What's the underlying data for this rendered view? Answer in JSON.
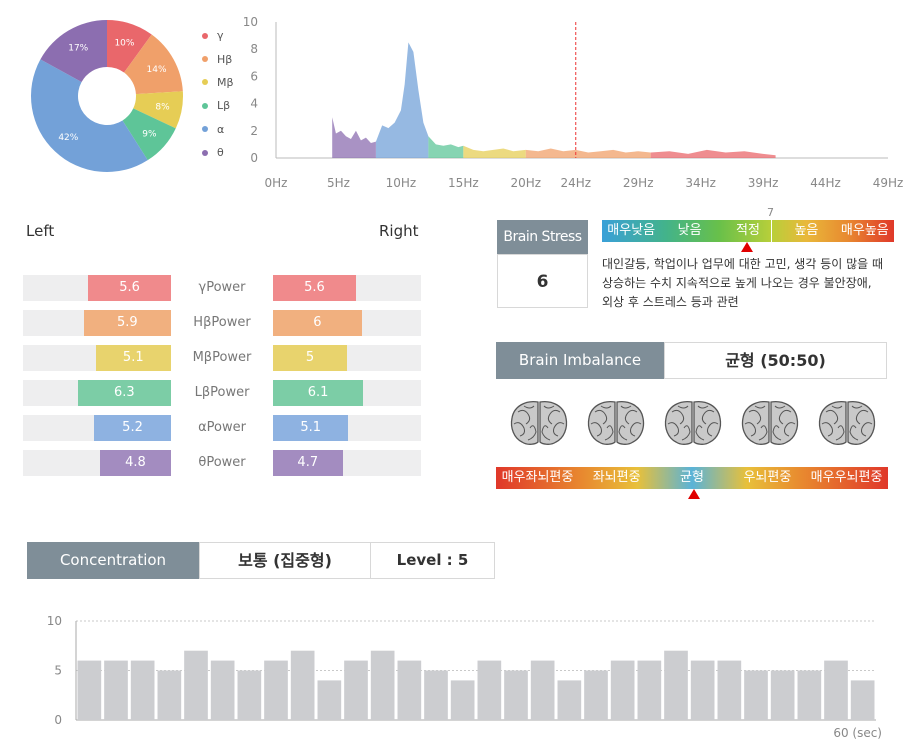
{
  "donut": {
    "slices": [
      {
        "name": "γ",
        "value": 10,
        "label": "10%",
        "color": "#e9676b"
      },
      {
        "name": "Hβ",
        "value": 14,
        "label": "14%",
        "color": "#f0a06a"
      },
      {
        "name": "Mβ",
        "value": 8,
        "label": "8%",
        "color": "#e6cd55"
      },
      {
        "name": "Lβ",
        "value": 9,
        "label": "9%",
        "color": "#5ec598"
      },
      {
        "name": "α",
        "value": 42,
        "label": "42%",
        "color": "#73a1d8"
      },
      {
        "name": "θ",
        "value": 17,
        "label": "17%",
        "color": "#8c6eb0"
      }
    ]
  },
  "chart_data": [
    {
      "type": "area",
      "x_ticks": [
        "0Hz",
        "5Hz",
        "10Hz",
        "15Hz",
        "20Hz",
        "24Hz",
        "29Hz",
        "34Hz",
        "39Hz",
        "44Hz",
        "49Hz"
      ],
      "y_ticks": [
        "0",
        "2",
        "4",
        "6",
        "8",
        "10"
      ],
      "ylim": [
        0,
        10
      ],
      "xlim": [
        0,
        49
      ],
      "marker_x": 24,
      "bands": [
        {
          "name": "θ",
          "color": "#8c6eb0",
          "x": [
            4.5,
            4.8,
            5.2,
            5.6,
            6.0,
            6.4,
            6.8,
            7.2,
            7.6,
            8.0
          ],
          "y": [
            3.0,
            1.8,
            2.0,
            1.6,
            1.4,
            2.0,
            1.3,
            1.5,
            1.1,
            1.2
          ]
        },
        {
          "name": "α",
          "color": "#73a1d8",
          "x": [
            8.0,
            8.5,
            9.0,
            9.5,
            10.0,
            10.3,
            10.6,
            11.0,
            11.4,
            11.8,
            12.2
          ],
          "y": [
            1.2,
            2.4,
            2.2,
            2.6,
            3.5,
            5.4,
            8.5,
            7.8,
            5.0,
            2.6,
            1.6
          ]
        },
        {
          "name": "Lβ",
          "color": "#5ec598",
          "x": [
            12.2,
            12.8,
            13.4,
            14.0,
            14.6,
            15.0
          ],
          "y": [
            1.6,
            1.0,
            0.9,
            1.0,
            0.8,
            0.9
          ]
        },
        {
          "name": "Mβ",
          "color": "#e6cd55",
          "x": [
            15.0,
            15.8,
            16.6,
            17.4,
            18.2,
            19.0,
            20.0
          ],
          "y": [
            0.9,
            0.6,
            0.5,
            0.6,
            0.7,
            0.5,
            0.6
          ]
        },
        {
          "name": "Hβ",
          "color": "#f0a06a",
          "x": [
            20.0,
            21.0,
            22.0,
            23.0,
            24.0,
            25.0,
            26.0,
            27.0,
            28.0,
            29.0,
            30.0
          ],
          "y": [
            0.6,
            0.5,
            0.7,
            0.5,
            0.6,
            0.4,
            0.5,
            0.6,
            0.4,
            0.5,
            0.4
          ]
        },
        {
          "name": "γ",
          "color": "#e9676b",
          "x": [
            30.0,
            31.5,
            33.0,
            34.5,
            36.0,
            37.5,
            39.0,
            40.0
          ],
          "y": [
            0.4,
            0.5,
            0.3,
            0.6,
            0.4,
            0.5,
            0.3,
            0.2
          ]
        }
      ]
    },
    {
      "type": "bar",
      "title": "Concentration",
      "y_ticks": [
        "0",
        "5",
        "10"
      ],
      "ylim": [
        0,
        10
      ],
      "values": [
        6,
        6,
        6,
        5,
        7,
        6,
        5,
        6,
        7,
        4,
        6,
        7,
        6,
        5,
        4,
        6,
        5,
        6,
        4,
        5,
        6,
        6,
        7,
        6,
        6,
        5,
        5,
        5,
        6,
        4
      ],
      "footer": "60 (sec)",
      "bar_color": "#cccdd0"
    }
  ],
  "lr": {
    "left_label": "Left",
    "right_label": "Right",
    "rows": [
      {
        "name": "γPower",
        "left": 5.6,
        "right": 5.6,
        "left_text": "5.6",
        "right_text": "5.6",
        "color": "#f08a8c"
      },
      {
        "name": "HβPower",
        "left": 5.9,
        "right": 6,
        "left_text": "5.9",
        "right_text": "6",
        "color": "#f1b07f"
      },
      {
        "name": "MβPower",
        "left": 5.1,
        "right": 5,
        "left_text": "5.1",
        "right_text": "5",
        "color": "#e8d36d"
      },
      {
        "name": "LβPower",
        "left": 6.3,
        "right": 6.1,
        "left_text": "6.3",
        "right_text": "6.1",
        "color": "#7ccda6"
      },
      {
        "name": "αPower",
        "left": 5.2,
        "right": 5.1,
        "left_text": "5.2",
        "right_text": "5.1",
        "color": "#8eb2e1"
      },
      {
        "name": "θPower",
        "left": 4.8,
        "right": 4.7,
        "left_text": "4.8",
        "right_text": "4.7",
        "color": "#a38cc0"
      }
    ]
  },
  "stress": {
    "title": "Brain Stress",
    "value": "6",
    "marker_number": "7",
    "scale": [
      "매우낮음",
      "낮음",
      "적정",
      "높음",
      "매우높음"
    ],
    "description": [
      "대인갈등, 학업이나 업무에 대한 고민, 생각 등이 많을 때",
      "상승하는 수치 지속적으로 높게 나오는 경우 불안장애,",
      "외상 후 스트레스 등과 관련"
    ]
  },
  "imbalance": {
    "title": "Brain Imbalance",
    "value": "균형 (50:50)",
    "scale": [
      "매우좌뇌편중",
      "좌뇌편중",
      "균형",
      "우뇌편중",
      "매우우뇌편중"
    ]
  },
  "concentration": {
    "title": "Concentration",
    "status": "보통 (집중형)",
    "level": "Level : 5"
  }
}
